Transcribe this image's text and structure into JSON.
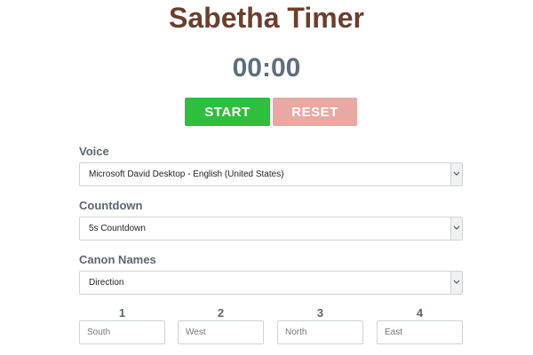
{
  "header": {
    "title": "Sabetha Timer",
    "clock": "00:00"
  },
  "controls": {
    "start_label": "START",
    "reset_label": "RESET"
  },
  "voice": {
    "label": "Voice",
    "selected": "Microsoft David Desktop - English (United States)"
  },
  "countdown": {
    "label": "Countdown",
    "selected": "5s Countdown"
  },
  "canon_names": {
    "label": "Canon Names",
    "selected": "Direction"
  },
  "canons": [
    {
      "number": "1",
      "placeholder": "South"
    },
    {
      "number": "2",
      "placeholder": "West"
    },
    {
      "number": "3",
      "placeholder": "North"
    },
    {
      "number": "4",
      "placeholder": "East"
    }
  ],
  "colors": {
    "title": "#6b3f2e",
    "clock": "#5e6e7d",
    "start": "#2fbf3e",
    "reset": "#e9a8a2"
  },
  "icons": {
    "dropdown": "chevron-down-icon"
  }
}
